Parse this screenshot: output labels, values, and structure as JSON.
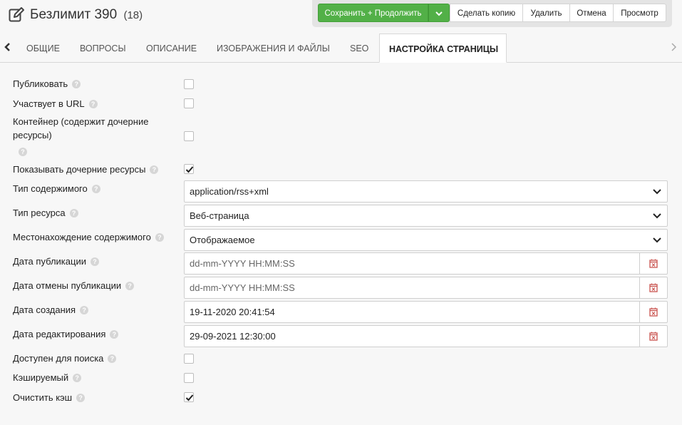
{
  "header": {
    "title": "Безлимит 390",
    "count": "(18)"
  },
  "toolbar": {
    "save_label": "Сохранить + Продолжить",
    "copy_label": "Сделать копию",
    "delete_label": "Удалить",
    "cancel_label": "Отмена",
    "preview_label": "Просмотр"
  },
  "tabs": [
    {
      "label": "ОБЩИЕ"
    },
    {
      "label": "ВОПРОСЫ"
    },
    {
      "label": "ОПИСАНИЕ"
    },
    {
      "label": "ИЗОБРАЖЕНИЯ И ФАЙЛЫ"
    },
    {
      "label": "SEO"
    },
    {
      "label": "НАСТРОЙКА СТРАНИЦЫ"
    }
  ],
  "active_tab": "НАСТРОЙКА СТРАНИЦЫ",
  "form": {
    "publish": {
      "label": "Публиковать",
      "checked": false
    },
    "in_url": {
      "label": "Участвует в URL",
      "checked": false
    },
    "container": {
      "label_line1": "Контейнер (содержит дочерние",
      "label_line2": "ресурсы)",
      "checked": false
    },
    "show_children": {
      "label": "Показывать дочерние ресурсы",
      "checked": true
    },
    "content_type": {
      "label": "Тип содержимого",
      "value": "application/rss+xml"
    },
    "resource_type": {
      "label": "Тип ресурса",
      "value": "Веб-страница"
    },
    "content_disposition": {
      "label": "Местонахождение содержимого",
      "value": "Отображаемое"
    },
    "pub_date": {
      "label": "Дата публикации",
      "placeholder": "dd-mm-YYYY HH:MM:SS"
    },
    "unpub_date": {
      "label": "Дата отмены публикации",
      "placeholder": "dd-mm-YYYY HH:MM:SS"
    },
    "created_date": {
      "label": "Дата создания",
      "value": "19-11-2020 20:41:54"
    },
    "edited_date": {
      "label": "Дата редактирования",
      "value": "29-09-2021 12:30:00"
    },
    "searchable": {
      "label": "Доступен для поиска",
      "checked": false
    },
    "cacheable": {
      "label": "Кэшируемый",
      "checked": false
    },
    "clear_cache": {
      "label": "Очистить кэш",
      "checked": true
    }
  },
  "help_glyph": "?",
  "colors": {
    "primary": "#52b047",
    "calendar_icon": "#c9534f"
  }
}
